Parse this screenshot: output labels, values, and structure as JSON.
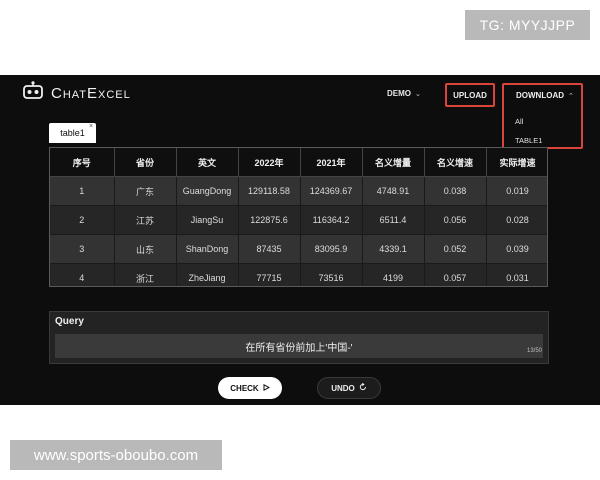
{
  "watermark_top": "TG: MYYJJPP",
  "watermark_bottom": "www.sports-oboubo.com",
  "header": {
    "logo_text": "ChatExcel",
    "demo_label": "DEMO",
    "upload_label": "UPLOAD",
    "download_label": "DOWNLOAD",
    "download_options": [
      "All",
      "TABLE1"
    ]
  },
  "tab": {
    "label": "table1",
    "close": "×"
  },
  "table": {
    "headers": [
      "序号",
      "省份",
      "英文",
      "2022年",
      "2021年",
      "名义增量",
      "名义增速",
      "实际增速"
    ],
    "rows": [
      [
        "1",
        "广东",
        "GuangDong",
        "129118.58",
        "124369.67",
        "4748.91",
        "0.038",
        "0.019"
      ],
      [
        "2",
        "江苏",
        "JiangSu",
        "122875.6",
        "116364.2",
        "6511.4",
        "0.056",
        "0.028"
      ],
      [
        "3",
        "山东",
        "ShanDong",
        "87435",
        "83095.9",
        "4339.1",
        "0.052",
        "0.039"
      ],
      [
        "4",
        "浙江",
        "ZheJiang",
        "77715",
        "73516",
        "4199",
        "0.057",
        "0.031"
      ]
    ]
  },
  "query": {
    "label": "Query",
    "value": "在所有省份前加上'中国-'",
    "count": "13/50"
  },
  "actions": {
    "check_label": "CHECK",
    "undo_label": "UNDO"
  },
  "icons": {
    "logo": "robot-icon",
    "check": "play-icon",
    "undo": "refresh-icon"
  },
  "colors": {
    "highlight": "#d9453a",
    "background": "#0d0d0d"
  }
}
